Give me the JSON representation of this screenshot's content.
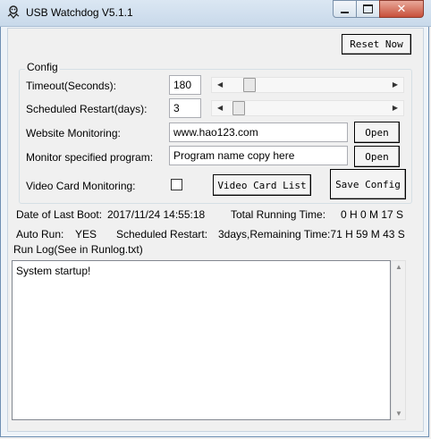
{
  "window": {
    "title": "USB Watchdog V5.1.1"
  },
  "toolbar": {
    "reset_label": "Reset Now"
  },
  "config": {
    "group_title": "Config",
    "timeout_label": "Timeout(Seconds):",
    "timeout_value": "180",
    "restart_label": "Scheduled Restart(days):",
    "restart_value": "3",
    "website_label": "Website Monitoring:",
    "website_value": "www.hao123.com",
    "program_label": "Monitor specified program:",
    "program_value": "Program name copy here",
    "open_label": "Open",
    "video_label": "Video Card Monitoring:",
    "video_checked": false,
    "video_list_label": "Video Card List",
    "save_label": "Save Config"
  },
  "status": {
    "last_boot_label": "Date of Last Boot:",
    "last_boot_value": "2017/11/24 14:55:18",
    "running_label": "Total Running Time:",
    "running_value": "0 H 0 M 17 S",
    "auto_run_label": "Auto Run:",
    "auto_run_value": "YES",
    "sched_label": "Scheduled Restart:",
    "sched_value": "3days,Remaining Time:71 H 59 M 43 S"
  },
  "log": {
    "title": "Run Log(See in Runlog.txt)",
    "content": "System startup!"
  },
  "sliders": {
    "timeout_fraction": 0.1,
    "restart_fraction": 0.03
  },
  "colors": {
    "titlebar": "#c8d9ea",
    "close_button": "#c7503a",
    "client_bg": "#f0f0f0"
  }
}
